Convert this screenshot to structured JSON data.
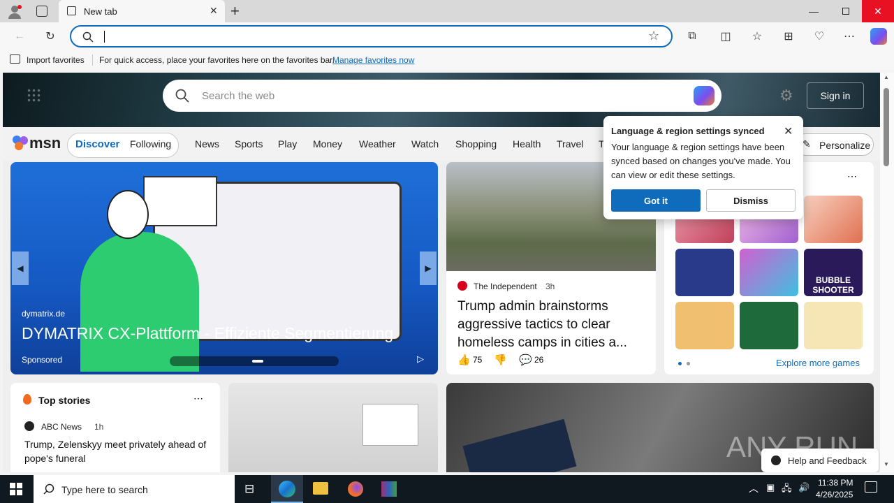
{
  "browser": {
    "tab_title": "New tab",
    "new_tab_icon": "plus-icon",
    "favbar": {
      "import_label": "Import favorites",
      "hint": "For quick access, place your favorites here on the favorites bar.",
      "manage_link": "Manage favorites now"
    }
  },
  "msn": {
    "search_placeholder": "Search the web",
    "sign_in": "Sign in",
    "logo": "msn",
    "tabs": [
      "Discover",
      "Following"
    ],
    "nav": [
      "News",
      "Sports",
      "Play",
      "Money",
      "Weather",
      "Watch",
      "Shopping",
      "Health",
      "Travel",
      "T"
    ],
    "personalize": "Personalize",
    "hero": {
      "source": "dymatrix.de",
      "title": "DYMATRIX CX-Plattform - Effiziente Segmentierung",
      "sponsored": "Sponsored"
    },
    "news_card": {
      "source": "The Independent",
      "age": "3h",
      "title": "Trump admin brainstorms aggressive tactics to clear homeless camps in cities a...",
      "likes": "75",
      "comments": "26"
    },
    "games": {
      "explore": "Explore more games",
      "bubble_label": "BUBBLE SHOOTER"
    },
    "top_stories": {
      "title": "Top stories",
      "source": "ABC News",
      "age": "1h",
      "headline": "Trump, Zelenskyy meet privately ahead of pope's funeral"
    },
    "help": "Help and Feedback",
    "watermark": "ANY RUN"
  },
  "popup": {
    "title": "Language & region settings synced",
    "body": "Your language & region settings have been synced based on changes you've made. You can view or edit these settings.",
    "primary": "Got it",
    "secondary": "Dismiss"
  },
  "taskbar": {
    "search_placeholder": "Type here to search",
    "time": "11:38 PM",
    "date": "4/26/2025"
  },
  "colors": {
    "accent": "#0f6cbd",
    "close_red": "#e81123",
    "got_it": "#0f6cbd"
  }
}
